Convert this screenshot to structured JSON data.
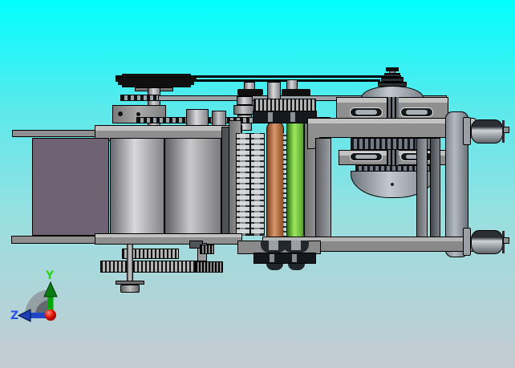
{
  "viewport": {
    "type": "3d-cad-assembly-view",
    "background": {
      "top_color": "#00feff",
      "bottom_color": "#c5cbd2"
    }
  },
  "triad": {
    "y_label": "Y",
    "z_label": "Z",
    "y_axis_color": "#2dd51e",
    "z_axis_color": "#2b52e8",
    "origin_color": "#d40000",
    "arc_color": "#8d9499"
  },
  "assembly": {
    "name": "roller-conveyor-machine",
    "parts": [
      {
        "id": "belt-pulley-stack",
        "color": "#111111"
      },
      {
        "id": "drive-belts",
        "color": "#000000"
      },
      {
        "id": "left-drum",
        "color": "#6f6273"
      },
      {
        "id": "guide-roller-front",
        "color": "#d9d9dc"
      },
      {
        "id": "guide-roller-rear",
        "color": "#c9c9cc"
      },
      {
        "id": "spiked-roller-left",
        "color": "#cdd1d4"
      },
      {
        "id": "spiked-roller-right",
        "color": "#cdd1d4"
      },
      {
        "id": "orange-roller",
        "color": "#d8996a"
      },
      {
        "id": "green-roller",
        "color": "#9ce95e"
      },
      {
        "id": "drive-chain",
        "color": "#101010"
      },
      {
        "id": "electric-motor",
        "color": "#9aa0aa"
      },
      {
        "id": "motor-cone-pulley",
        "color": "#2a3036"
      },
      {
        "id": "frame",
        "color": "#8f8f8f"
      },
      {
        "id": "caster-upper",
        "color": "#aeb2b8"
      },
      {
        "id": "caster-lower",
        "color": "#aeb2b8"
      },
      {
        "id": "gear-train",
        "color": "#b4b4b4"
      }
    ]
  }
}
